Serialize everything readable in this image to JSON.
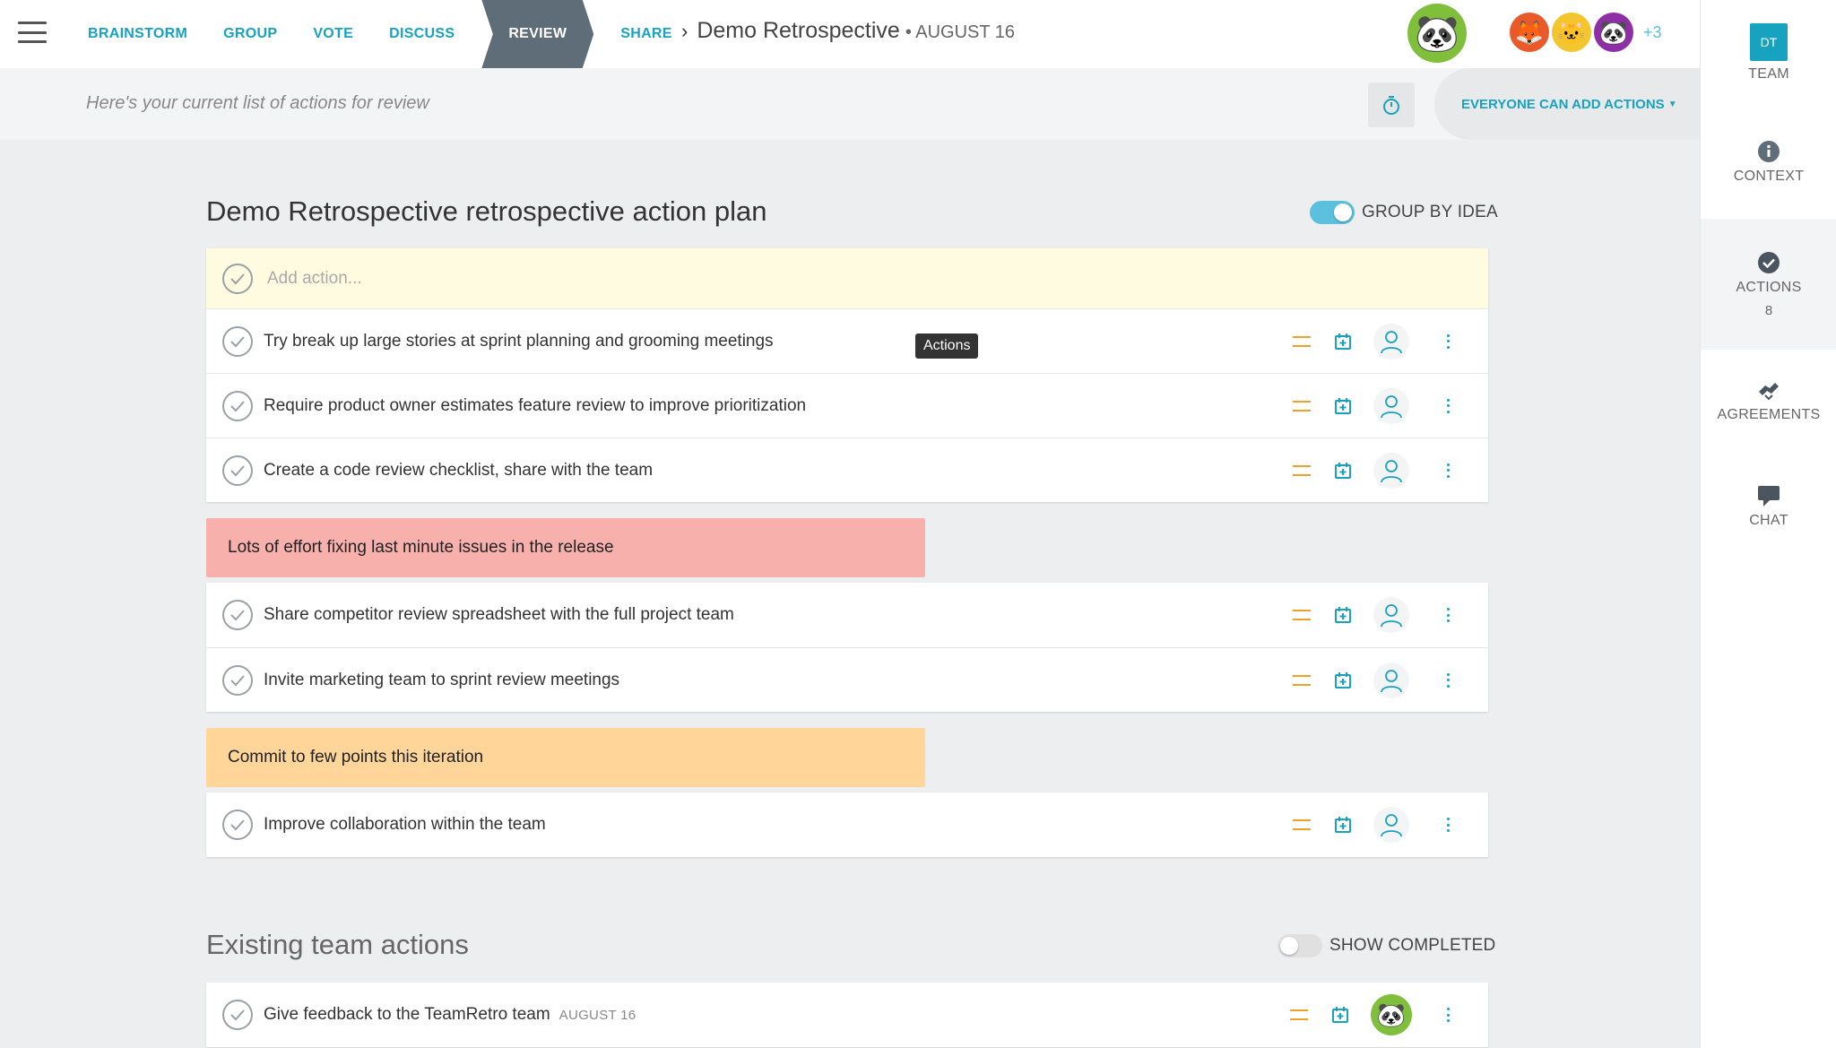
{
  "nav": {
    "steps": [
      "BRAINSTORM",
      "GROUP",
      "VOTE",
      "DISCUSS",
      "REVIEW",
      "SHARE"
    ],
    "breadcrumb_title": "Demo Retrospective",
    "breadcrumb_date": "• AUGUST 16",
    "more_participants": "+3"
  },
  "subheader": {
    "text": "Here's your current list of actions for review",
    "permission": "EVERYONE CAN ADD ACTIONS"
  },
  "rail": {
    "team_badge": "DT",
    "team": "TEAM",
    "context": "CONTEXT",
    "actions": "ACTIONS",
    "actions_count": "8",
    "agreements": "AGREEMENTS",
    "chat": "CHAT"
  },
  "plan": {
    "title": "Demo Retrospective retrospective action plan",
    "group_toggle": "GROUP BY IDEA",
    "add_placeholder": "Add action...",
    "tooltip": "Actions",
    "group1": [
      "Try break up large stories at sprint planning and grooming meetings",
      "Require product owner estimates feature review to improve prioritization",
      "Create a code review checklist, share with the team"
    ],
    "idea2": "Lots of effort fixing last minute issues in the release",
    "group2": [
      "Share competitor review spreadsheet with the full project team",
      "Invite marketing team to sprint review meetings"
    ],
    "idea3": "Commit to few points this iteration",
    "group3": [
      "Improve collaboration within the team"
    ]
  },
  "existing": {
    "title": "Existing team actions",
    "toggle": "SHOW COMPLETED",
    "items": [
      {
        "text": "Give feedback to the TeamRetro team",
        "date": "AUGUST 16"
      }
    ]
  },
  "colors": {
    "accent": "#17a2c0",
    "idea_red": "#f8b0ad",
    "idea_orange": "#ffd599",
    "add_row": "#fffbe0"
  }
}
